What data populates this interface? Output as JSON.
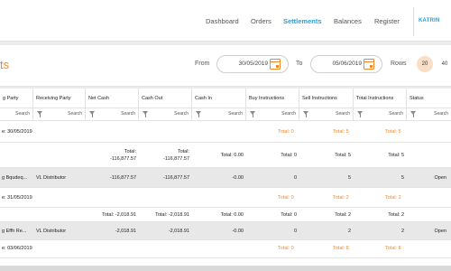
{
  "nav": {
    "items": [
      {
        "label": "Dashboard",
        "active": false
      },
      {
        "label": "Orders",
        "active": false
      },
      {
        "label": "Settlements",
        "active": true
      },
      {
        "label": "Balances",
        "active": false
      },
      {
        "label": "Register",
        "active": false
      }
    ],
    "user": "KATRIN"
  },
  "header": {
    "title": "ts",
    "from_label": "From",
    "from_date": "30/05/2019",
    "to_label": "To",
    "to_date": "05/06/2019",
    "rows_label": "Rows",
    "rows_options": [
      "20",
      "40"
    ],
    "rows_selected": "20"
  },
  "table": {
    "columns": [
      "g Party",
      "Receiving Party",
      "Net Cash",
      "Cash Out",
      "Cash In",
      "Buy Instructions",
      "Sell Instructions",
      "Total Instructions",
      "Status"
    ],
    "search_label": "Search",
    "groups": [
      {
        "header": "e: 30/05/2019",
        "totals_buy": "Total: 0",
        "totals_sell": "Total: 5",
        "totals_total": "Total: 5",
        "subtotal": {
          "net_label": "Total:",
          "net_value": "-116,877.57",
          "cash_out_label": "Total:",
          "cash_out_value": "-116,877.57",
          "cash_in": "Total: 0.00",
          "buy": "Total: 0",
          "sell": "Total: 5",
          "total": "Total: 5"
        },
        "detail": {
          "sending": "g Bqudeq...",
          "receiving": "VL Distributor",
          "net": "-116,877.57",
          "cash_out": "-116,877.57",
          "cash_in": "-0.00",
          "buy": "0",
          "sell": "5",
          "total": "5",
          "status": "Open"
        }
      },
      {
        "header": "e: 31/05/2019",
        "totals_buy": "Total: 0",
        "totals_sell": "Total: 2",
        "totals_total": "Total: 2",
        "subtotal": {
          "net": "Total: -2,018.91",
          "cash_out": "Total: -2,018.91",
          "cash_in": "Total: 0.00",
          "buy": "Total: 0",
          "sell": "Total: 2",
          "total": "Total: 2"
        },
        "detail": {
          "sending": "g Effh Re...",
          "receiving": "VL Distributor",
          "net": "-2,018.91",
          "cash_out": "-2,018.91",
          "cash_in": "-0.00",
          "buy": "0",
          "sell": "2",
          "total": "2",
          "status": "Open"
        }
      },
      {
        "header": "e: 03/06/2019",
        "totals_buy": "Total: 0",
        "totals_sell": "Total: 8",
        "totals_total": "Total: 8"
      }
    ]
  }
}
